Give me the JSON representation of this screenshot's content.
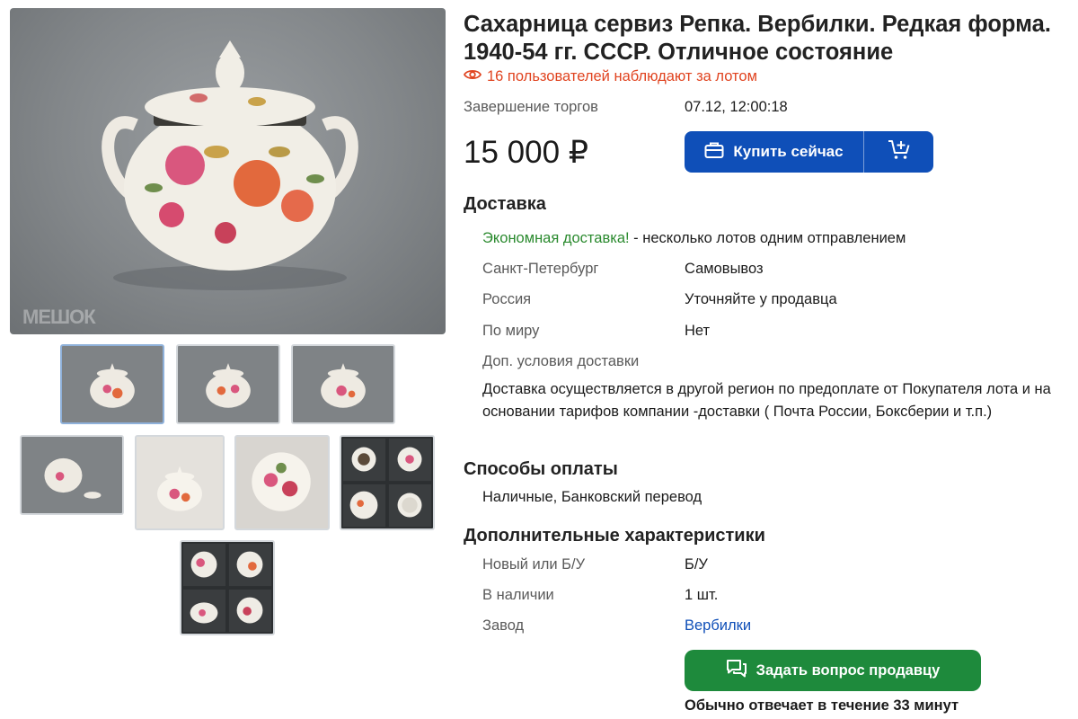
{
  "title_line1": "Сахарница сервиз Репка. Вербилки. Редкая форма.",
  "title_line2": "1940-54 гг. СССР. Отличное состояние",
  "watchers_text": "16 пользователей наблюдают за лотом",
  "auction_end": {
    "label": "Завершение торгов",
    "value": "07.12, 12:00:18"
  },
  "price": "15 000 ₽",
  "buy_now_label": "Купить сейчас",
  "delivery": {
    "heading": "Доставка",
    "economy_highlight": "Экономная доставка!",
    "economy_rest": " - несколько лотов одним отправлением",
    "rows": [
      {
        "label": "Санкт-Петербург",
        "value": "Самовывоз"
      },
      {
        "label": "Россия",
        "value": "Уточняйте у продавца"
      },
      {
        "label": "По миру",
        "value": "Нет"
      }
    ],
    "extra_label": "Доп. условия доставки",
    "extra_text": "Доставка осуществляется в другой регион по предоплате от Покупателя лота и на основании тарифов компании -доставки ( Почта России, Боксберии и т.п.)"
  },
  "payment": {
    "heading": "Способы оплаты",
    "methods": "Наличные, Банковский перевод"
  },
  "characteristics": {
    "heading": "Дополнительные характеристики",
    "rows": [
      {
        "label": "Новый или Б/У",
        "value": "Б/У"
      },
      {
        "label": "В наличии",
        "value": "1 шт."
      },
      {
        "label": "Завод",
        "value": "Вербилки"
      }
    ]
  },
  "ask_seller_label": "Задать вопрос продавцу",
  "reply_time": "Обычно отвечает в течение 33 минут",
  "watermark": "МЕШОК",
  "colors": {
    "accent_blue": "#0f4fb8",
    "green_button": "#1e8a3c",
    "watchers_red": "#e0431f",
    "green_text": "#2a8a2e"
  }
}
